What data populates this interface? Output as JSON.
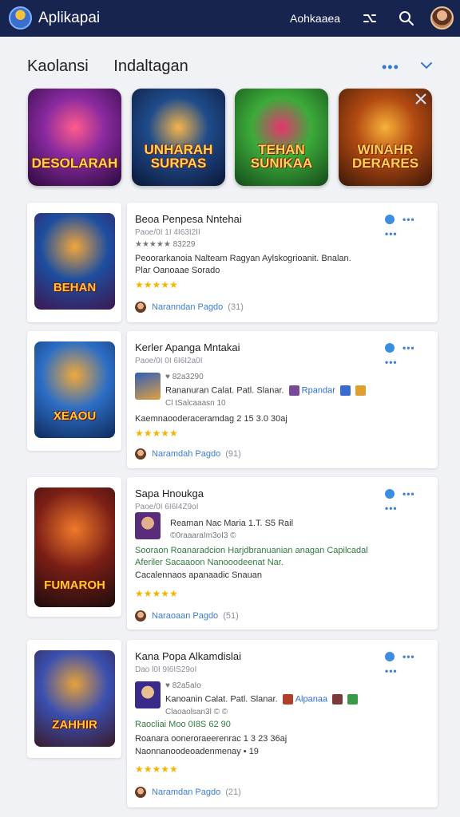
{
  "app": {
    "title": "Aplikapai",
    "nav_link": "Aohkaaea",
    "icons": [
      "app-logo-icon",
      "shuffle-icon",
      "search-icon",
      "user-avatar"
    ]
  },
  "header": {
    "tab_1": "Kaolansi",
    "tab_2": "Indaltagan",
    "more": "•••"
  },
  "featured": [
    {
      "title": "DESOLARAH",
      "colors": [
        "#2b0a3c",
        "#8a2aa0",
        "#ff5c8a"
      ]
    },
    {
      "title": "UNHARAH SURPAS",
      "colors": [
        "#0b1638",
        "#1f4c8a",
        "#f6b54a"
      ]
    },
    {
      "title": "TEHAN SUNIKAA",
      "colors": [
        "#144a1a",
        "#3cab3a",
        "#e6356f"
      ]
    },
    {
      "title": "WINAHR DERARES",
      "colors": [
        "#3b1708",
        "#b34a12",
        "#f7b23a"
      ]
    }
  ],
  "cards": [
    {
      "title": "Beoa Penpesa Nntehai",
      "meta": "Paoe/0I 1I 4I63I2II",
      "rating_line": "★★★★★ 83229",
      "desc_1": "Peoorarkanoia Nalteam Ragyan Aylskogrioanit. Bnalan.",
      "desc_2": "Plar Oanoaae Sorado",
      "stars": "★★★★★",
      "footer_label": "Naranndan  Pagdo",
      "footer_count": "(31)",
      "thumb_title": "BEHAN",
      "thumb_colors": [
        "#3d1750",
        "#1d4ea0",
        "#f3a63a"
      ]
    },
    {
      "title": "Kerler Apanga Mntakai",
      "meta": "Paoe/0I 0I 6I6I2a0I",
      "sub_meta": "♥ 82a3290",
      "inline_text": "Rananuran Calat. Patl. Slanar.",
      "inline_link": "Rpandar",
      "sub_meta_2": "Cl tSalcaaasn 10",
      "desc_1": "Kaemnaooderaceramdag  2 15 3.0 30aj",
      "stars": "★★★★★",
      "footer_label": "Naramdah  Pagdo",
      "footer_count": "(91)",
      "thumb_title": "XEAOU",
      "thumb_colors": [
        "#0f2a5c",
        "#2c6ec5",
        "#f0a83a"
      ]
    },
    {
      "title": "Sapa Hnoukga",
      "meta": "Paoe/0I 6I6I4Z9oI",
      "inline_text": "Reaman Nac Maria  1.T.  S5 Rail",
      "sub_meta_2": "©0raaaraIm3oI3  ©",
      "desc_green_1": "Sooraon Roanaradcion Harjdbranuanian anagan Capilcadal",
      "desc_green_2": "Aferiler Sacaaoon Nanooodeenat Nar.",
      "desc_1": "Cacalennaos apanaadic Snauan",
      "stars": "★★★★★",
      "footer_label": "Naraoaan  Pagdo",
      "footer_count": "(51)",
      "thumb_title": "FUMAROH",
      "thumb_colors": [
        "#1d0d0d",
        "#7b1e16",
        "#f07a2a"
      ]
    },
    {
      "title": "Kana Popa Alkamdislai",
      "meta": "Dao l0I 9I6IS29oI",
      "sub_meta": "♥ 82a5aIo",
      "inline_text": "Kanoanin Calat. Patl. Slanar.",
      "inline_link": "Alpanaa",
      "sub_meta_2": "Claoaolsan3l  ©  ©",
      "desc_green_1": "Raocliai Moo 0I8S  62 90",
      "desc_1": "Roanara ooneroraeerenrac  1 3 23 36aj",
      "desc_2": "Naonnanoodeoadenmenay  • 19",
      "stars": "★★★★★",
      "footer_label": "Naramdan  Pagdo",
      "footer_count": "(21)",
      "thumb_title": "ZAHHIR",
      "thumb_colors": [
        "#3a1a2a",
        "#3a4fb0",
        "#e6a23a"
      ]
    }
  ],
  "colors": {
    "topbar": "#16244f",
    "accent": "#3b8de0",
    "stars": "#f5b400",
    "green_text": "#2f7a3d"
  }
}
